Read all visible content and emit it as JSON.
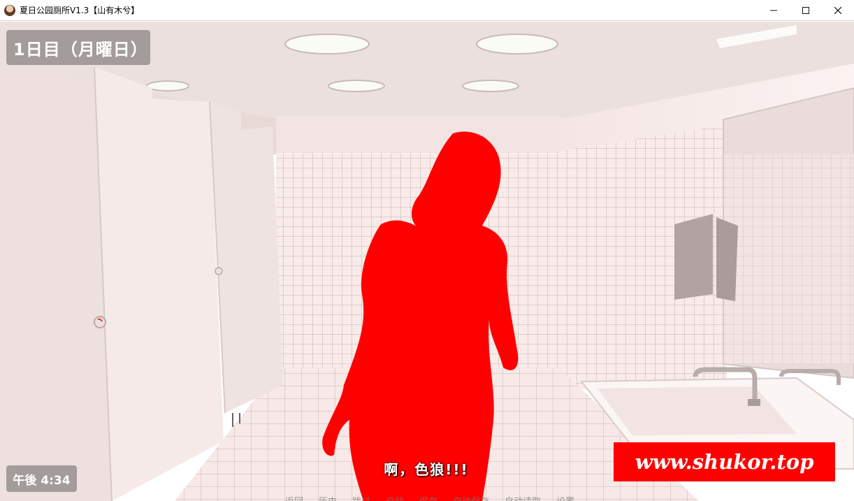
{
  "window": {
    "title": "夏日公园厕所V1.3【山有木兮】",
    "icon": "portrait-app-icon",
    "controls": [
      "minimize-icon",
      "maximize-icon",
      "close-icon"
    ]
  },
  "hud": {
    "day": "1日目（月曜日）",
    "time": "午後 4:34"
  },
  "dialogue": {
    "text": "啊，色狼!!!"
  },
  "quick_menu": {
    "items": [
      "返回",
      "历史",
      "跳过",
      "自动",
      "保存",
      "自动保存",
      "自动读取",
      "设置"
    ]
  },
  "watermark": {
    "text": "www.shukor.top",
    "color": "#ff0000"
  },
  "colors": {
    "silhouette": "#ff0000",
    "tile": "#f6e6e4",
    "wall": "#f3e3e1"
  }
}
